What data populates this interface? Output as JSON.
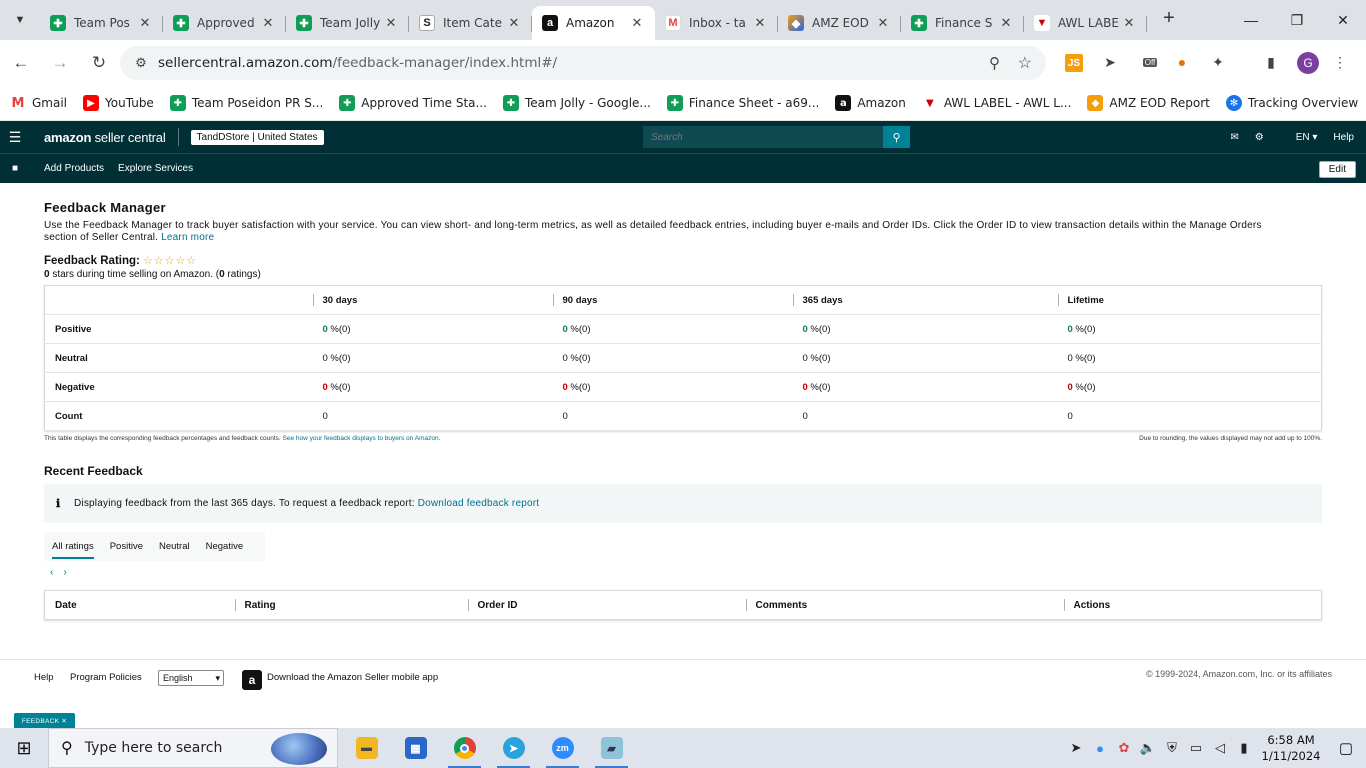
{
  "browser": {
    "tabs": [
      {
        "title": "Team Pos",
        "icon": "sheets-icon",
        "active": false
      },
      {
        "title": "Approved",
        "icon": "sheets-icon",
        "active": false
      },
      {
        "title": "Team Jolly",
        "icon": "sheets-icon",
        "active": false
      },
      {
        "title": "Item Cate",
        "icon": "s-icon",
        "active": false
      },
      {
        "title": "Amazon",
        "icon": "amazon-icon",
        "active": true
      },
      {
        "title": "Inbox - ta",
        "icon": "gmail-icon",
        "active": false
      },
      {
        "title": "AMZ EOD",
        "icon": "amz-icon",
        "active": false
      },
      {
        "title": "Finance S",
        "icon": "sheets-icon",
        "active": false
      },
      {
        "title": "AWL LABE",
        "icon": "awl-icon",
        "active": false
      }
    ],
    "url_host": "sellercentral.amazon.com",
    "url_path": "/feedback-manager/index.html#/",
    "profile_initial": "G",
    "ext_js_label": "JS",
    "ext_off_label": "Off",
    "bookmarks": [
      {
        "label": "Gmail",
        "icon": "gmail-icon"
      },
      {
        "label": "YouTube",
        "icon": "youtube-icon"
      },
      {
        "label": "Team Poseidon PR S...",
        "icon": "sheets-icon"
      },
      {
        "label": "Approved Time Sta...",
        "icon": "sheets-icon"
      },
      {
        "label": "Team Jolly - Google...",
        "icon": "sheets-icon"
      },
      {
        "label": "Finance Sheet - a69...",
        "icon": "sheets-icon"
      },
      {
        "label": "Amazon",
        "icon": "amazon-icon"
      },
      {
        "label": "AWL LABEL - AWL L...",
        "icon": "awl-icon"
      },
      {
        "label": "AMZ EOD Report",
        "icon": "amz-icon"
      },
      {
        "label": "Tracking Overview",
        "icon": "tracking-icon"
      }
    ]
  },
  "seller_central": {
    "logo_bold": "amazon",
    "logo_light": " seller central",
    "store": "TandDStore | United States",
    "search_placeholder": "Search",
    "language": "EN",
    "help": "Help",
    "nav": [
      "Add Products",
      "Explore Services"
    ],
    "edit": "Edit"
  },
  "feedback": {
    "title": "Feedback Manager",
    "description": "Use the Feedback Manager to track buyer satisfaction with your service. You can view short- and long-term metrics, as well as detailed feedback entries, including buyer e-mails and Order IDs. Click the Order ID to view transaction details within the Manage Orders section of Seller Central.",
    "learn_more": "Learn more",
    "rating_label": "Feedback Rating:",
    "stars": "☆☆☆☆☆",
    "stars_value": "0",
    "stars_text": " stars during time selling on Amazon. (",
    "ratings_count": "0",
    "ratings_suffix": " ratings)",
    "columns": [
      "30 days",
      "90 days",
      "365 days",
      "Lifetime"
    ],
    "rows": [
      {
        "label": "Positive",
        "type": "pos",
        "cells": [
          "0",
          "0",
          "0",
          "0"
        ],
        "suffix": " %(0)"
      },
      {
        "label": "Neutral",
        "type": "neu",
        "cells": [
          "0",
          "0",
          "0",
          "0"
        ],
        "suffix": " %(0)"
      },
      {
        "label": "Negative",
        "type": "neg",
        "cells": [
          "0",
          "0",
          "0",
          "0"
        ],
        "suffix": " %(0)"
      },
      {
        "label": "Count",
        "type": "count",
        "cells": [
          "0",
          "0",
          "0",
          "0"
        ],
        "suffix": ""
      }
    ],
    "note_left": "This table displays the corresponding feedback percentages and feedback counts.",
    "note_link": "See how your feedback displays to buyers on Amazon.",
    "note_right": "Due to rounding, the values displayed may not add up to 100%."
  },
  "recent": {
    "title": "Recent Feedback",
    "info_text": "Displaying feedback from the last 365 days. To request a feedback report:",
    "info_link": "Download feedback report",
    "filter_tabs": [
      "All ratings",
      "Positive",
      "Neutral",
      "Negative"
    ],
    "active_filter": "All ratings",
    "pager_prev": "‹",
    "pager_next": "›",
    "columns": [
      "Date",
      "Rating",
      "Order ID",
      "Comments",
      "Actions"
    ]
  },
  "footer": {
    "help": "Help",
    "policies": "Program Policies",
    "language": "English",
    "app_text": "Download the Amazon Seller mobile app",
    "copyright": "© 1999-2024, Amazon.com, Inc. or its affiliates",
    "feedback_tab": "FEEDBACK ✕"
  },
  "taskbar": {
    "search_placeholder": "Type here to search",
    "time": "6:58 AM",
    "date": "1/11/2024"
  }
}
